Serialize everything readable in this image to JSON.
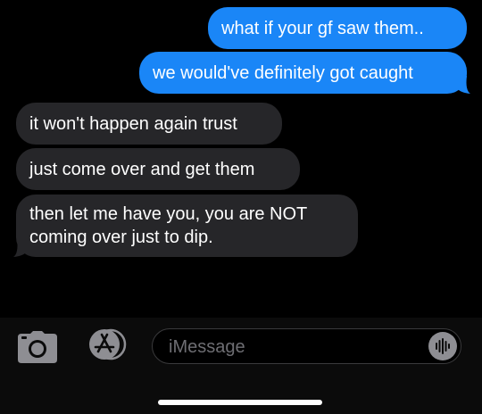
{
  "messages": [
    {
      "direction": "sent",
      "text": "what if your gf saw them.."
    },
    {
      "direction": "sent",
      "text": "we would've definitely got caught"
    },
    {
      "direction": "received",
      "text": "it won't happen again trust"
    },
    {
      "direction": "received",
      "text": "just come over and get them"
    },
    {
      "direction": "received",
      "line1": "then let me have you, you are NOT",
      "line2": "coming over just to dip."
    }
  ],
  "composer": {
    "placeholder": "iMessage",
    "camera_icon": "camera-icon",
    "appstore_icon": "app-store-icon",
    "audio_icon": "audio-waveform-icon"
  },
  "colors": {
    "sent_bubble": "#1a86f7",
    "received_bubble": "#262629",
    "background": "#000000"
  }
}
